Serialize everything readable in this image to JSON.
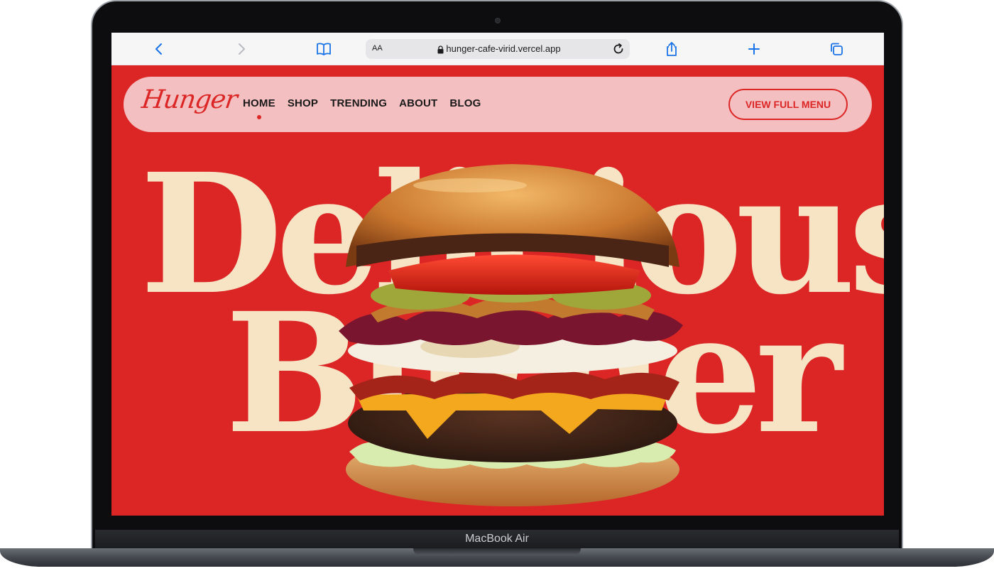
{
  "browser": {
    "text_size_label": "AA",
    "url": "hunger-cafe-virid.vercel.app"
  },
  "site": {
    "logo": "Hunger",
    "nav": [
      {
        "label": "HOME",
        "active": true
      },
      {
        "label": "SHOP",
        "active": false
      },
      {
        "label": "TRENDING",
        "active": false
      },
      {
        "label": "ABOUT",
        "active": false
      },
      {
        "label": "BLOG",
        "active": false
      }
    ],
    "cta_label": "VIEW FULL MENU",
    "hero": {
      "line1": "Delicious",
      "line2": "Burger"
    },
    "colors": {
      "primary": "#dc2626",
      "nav_bg": "#f4bfc0",
      "hero_text": "#f6e4c4"
    }
  },
  "device": {
    "label": "MacBook Air"
  },
  "icons": [
    "back-icon",
    "forward-icon",
    "bookmarks-icon",
    "lock-icon",
    "reload-icon",
    "share-icon",
    "new-tab-icon",
    "tabs-icon"
  ]
}
